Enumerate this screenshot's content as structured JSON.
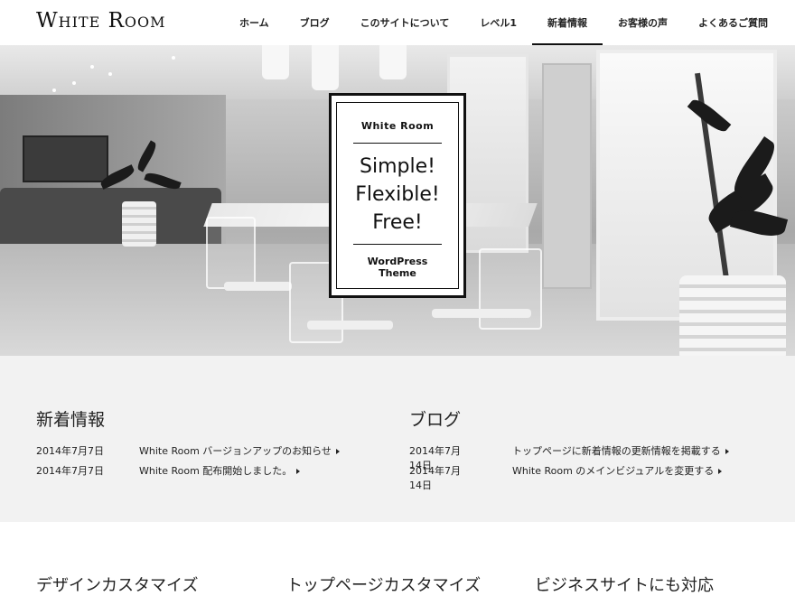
{
  "header": {
    "logo": "White Room",
    "nav": [
      {
        "label": "ホーム",
        "active": false
      },
      {
        "label": "ブログ",
        "active": false
      },
      {
        "label": "このサイトについて",
        "active": false
      },
      {
        "label": "レベル1",
        "active": false
      },
      {
        "label": "新着情報",
        "active": true
      },
      {
        "label": "お客様の声",
        "active": false
      },
      {
        "label": "よくあるご質問",
        "active": false
      }
    ]
  },
  "hero": {
    "badge_title": "White Room",
    "lines": [
      "Simple!",
      "Flexible!",
      "Free!"
    ],
    "foot_line1": "WordPress",
    "foot_line2": "Theme"
  },
  "news": {
    "heading": "新着情報",
    "posts": [
      {
        "date": "2014年7月7日",
        "title": "White Room バージョンアップのお知らせ"
      },
      {
        "date": "2014年7月7日",
        "title": "White Room 配布開始しました。"
      }
    ]
  },
  "blog": {
    "heading": "ブログ",
    "posts": [
      {
        "date": "2014年7月14日",
        "title": "トップページに新着情報の更新情報を掲載する"
      },
      {
        "date": "2014年7月14日",
        "title": "White Room のメインビジュアルを変更する"
      }
    ]
  },
  "features": [
    "デザインカスタマイズ",
    "トップページカスタマイズ",
    "ビジネスサイトにも対応"
  ]
}
